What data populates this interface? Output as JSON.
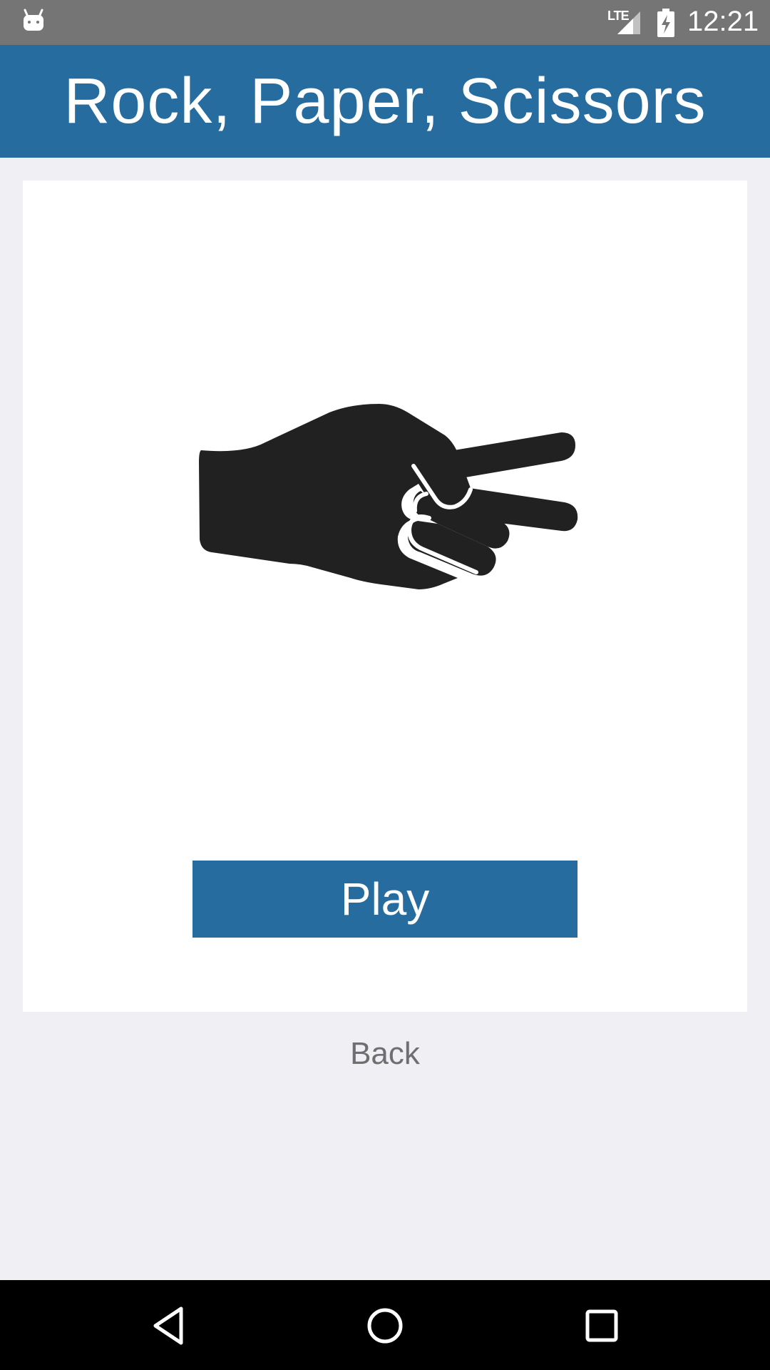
{
  "status_bar": {
    "network_label": "LTE",
    "time": "12:21",
    "icons": [
      "android-icon",
      "signal-icon",
      "battery-charging-icon"
    ]
  },
  "app_bar": {
    "title": "Rock, Paper, Scissors"
  },
  "card": {
    "image_icon": "scissors-hand-icon",
    "play_label": "Play"
  },
  "back_label": "Back",
  "nav_bar": {
    "icons": [
      "nav-back-icon",
      "nav-home-icon",
      "nav-recents-icon"
    ]
  },
  "colors": {
    "accent": "#266c9e",
    "background": "#efeff4",
    "status_bar": "#757575"
  }
}
